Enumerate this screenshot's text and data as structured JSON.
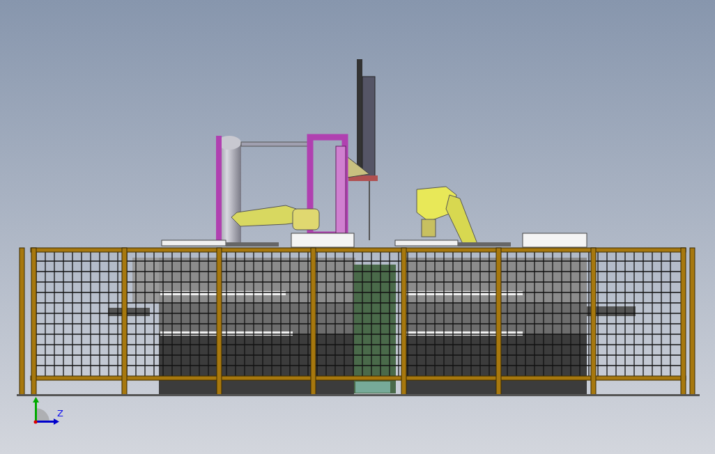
{
  "viewport": {
    "triad": {
      "axis_label": "Z"
    }
  }
}
